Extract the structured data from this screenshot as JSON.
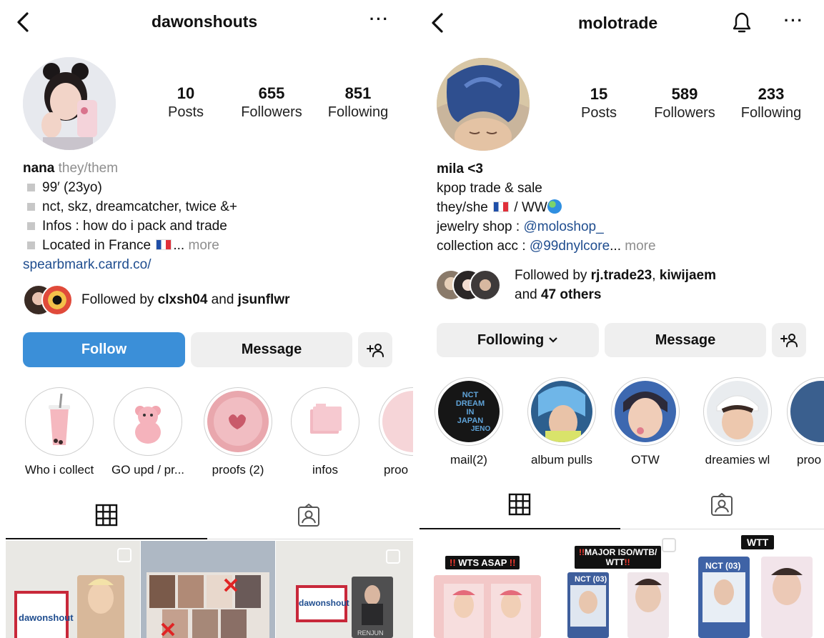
{
  "left": {
    "username": "dawonshouts",
    "stats": [
      {
        "num": "10",
        "label": "Posts"
      },
      {
        "num": "655",
        "label": "Followers"
      },
      {
        "num": "851",
        "label": "Following"
      }
    ],
    "name": "nana",
    "pronouns": "they/them",
    "bio": [
      "99′ (23yo)",
      "nct, skz, dreamcatcher, twice &+",
      "Infos : how do i pack and trade",
      "Located in France"
    ],
    "ellipsis": "...",
    "more": "more",
    "link": "spearbmark.carrd.co/",
    "followed_prefix": "Followed by ",
    "followed_user1": "clxsh04",
    "followed_and": " and ",
    "followed_user2": "jsunflwr",
    "btn_follow": "Follow",
    "btn_message": "Message",
    "highlights": [
      "Who i collect",
      "GO upd / pr...",
      "proofs (2)",
      "infos",
      "proo"
    ],
    "posts": [
      {
        "text": "dawonshout"
      },
      {
        "text": ""
      },
      {
        "text": "dawonshout",
        "card": "RENJUN"
      }
    ]
  },
  "right": {
    "username": "molotrade",
    "stats": [
      {
        "num": "15",
        "label": "Posts"
      },
      {
        "num": "589",
        "label": "Followers"
      },
      {
        "num": "233",
        "label": "Following"
      }
    ],
    "name": "mila <3",
    "bio1": "kpop trade & sale",
    "bio2a": "they/she ",
    "bio2b": " / WW",
    "bio3a": "jewelry shop : ",
    "bio3b": "@moloshop_",
    "bio4a": "collection acc : ",
    "bio4b": "@99dnylcore",
    "ellipsis": "...",
    "more": "more",
    "followed_prefix": "Followed by ",
    "followed_user1": "rj.trade23",
    "followed_comma": ", ",
    "followed_user2": "kiwijaem",
    "followed_and": "and ",
    "followed_others": "47 others",
    "btn_following": "Following",
    "btn_message": "Message",
    "highlights": [
      "mail(2)",
      "album pulls",
      "OTW",
      "dreamies wl",
      "proo"
    ],
    "highlight_text": "NCT DREAM IN JAPAN",
    "highlight_text2": "JENO",
    "posts": [
      {
        "tag_pre": "!!",
        "tag": " WTS ASAP ",
        "tag_post": "!!"
      },
      {
        "tag_pre": "!!",
        "tag": "MAJOR ISO/WTB/",
        "tag_line2": "WTT",
        "tag_post": "!!",
        "card": "NCT (03)"
      },
      {
        "tag": "WTT",
        "card": "NCT (03)"
      }
    ]
  },
  "colors": {
    "follow_blue": "#3b8fd8",
    "link_blue": "#1f4d8f",
    "button_grey": "#efefef"
  }
}
